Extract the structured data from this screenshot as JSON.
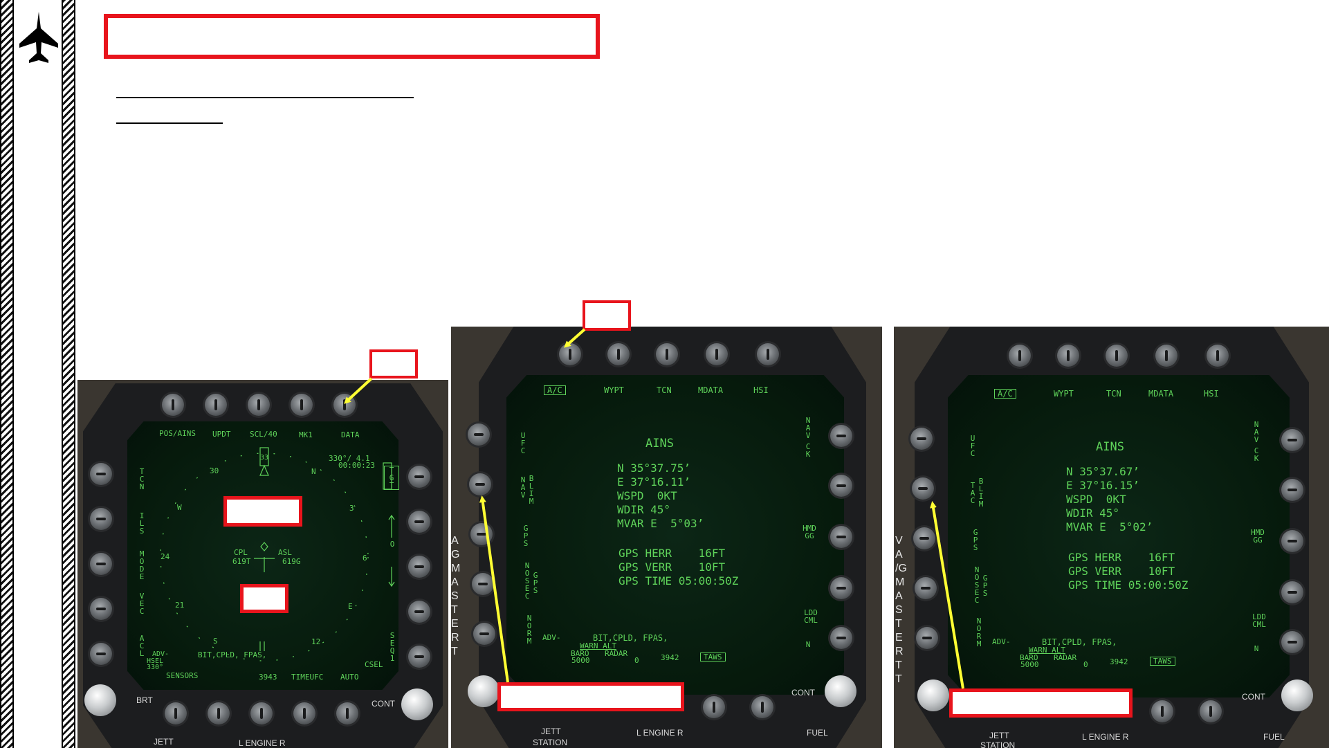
{
  "colors": {
    "accent_red": "#e8141c",
    "arrow_yellow": "#ffff33",
    "display_green": "#5fd35a"
  },
  "logo": {
    "icon": "fighter-jet-icon"
  },
  "mfd1": {
    "top_labels": [
      "POS/AINS",
      "UPDT",
      "SCL/40",
      "MK1",
      "DATA"
    ],
    "left_labels": [
      "TCN",
      "ILS",
      "MODE",
      "VEC",
      "ACL"
    ],
    "right_labels": [
      "TGT",
      "O",
      "SEQ1"
    ],
    "bottom_labels": [
      "SENSORS",
      "3943",
      "TIMEUFC",
      "AUTO"
    ],
    "compass": [
      "30",
      "N",
      "W",
      "3",
      "24",
      "6",
      "21",
      "E",
      "S",
      "12"
    ],
    "top_right_readout_1": "330°/ 4.1",
    "top_right_readout_2": "00:00:23",
    "heading_box": "33",
    "cpl": "CPL",
    "asl": "ASL",
    "cpl_value": "619T",
    "asl_value": "619G",
    "adv": "ADV-",
    "hsel": "HSEL",
    "hsel_value": "330°",
    "bit_line": "BIT,CPLD, FPAS,",
    "csel": "CSEL",
    "brt": "BRT",
    "cont": "CONT",
    "jett": "JETT",
    "engine": "L ENGINE R"
  },
  "mfd2": {
    "top_labels": [
      "A/C",
      "WYPT",
      "TCN",
      "MDATA",
      "HSI"
    ],
    "left_labels": [
      "UFC",
      "NAV",
      "BLIM",
      "GPS",
      "NOSEC",
      "GPS",
      "NORM"
    ],
    "right_labels": [
      "NAV",
      "CK",
      "HMDGG",
      "LDDCML",
      "N"
    ],
    "title": "AINS",
    "lat": "N 35°37.75’",
    "lon": "E 37°16.11’",
    "wspd": "WSPD  0KT",
    "wdir": "WDIR 45°",
    "mvar": "MVAR E  5°03’",
    "gps_herr": "GPS HERR    16FT",
    "gps_verr": "GPS VERR    10FT",
    "gps_time": "GPS TIME 05:00:50Z",
    "adv": "ADV-",
    "bit_line": "BIT,CPLD, FPAS,",
    "warn_alt": "WARN ALT",
    "baro": "BARO",
    "radar": "RADAR",
    "baro_value": "5000",
    "radar_value": "0",
    "alt_value": "3942",
    "taws": "TAWS",
    "cont": "CONT",
    "jett": "JETT",
    "station": "STATION",
    "engine": "L ENGINE R",
    "fuel": "FUEL",
    "side_letters": "A G MASTER T"
  },
  "mfd3": {
    "top_labels": [
      "A/C",
      "WYPT",
      "TCN",
      "MDATA",
      "HSI"
    ],
    "left_labels": [
      "UFC",
      "TAC",
      "BLIM",
      "GPS",
      "NOSEC",
      "GPS",
      "NORM"
    ],
    "right_labels": [
      "NAV",
      "CK",
      "HMDGG",
      "LDDCML",
      "N"
    ],
    "title": "AINS",
    "lat": "N 35°37.67’",
    "lon": "E 37°16.15’",
    "wspd": "WSPD  0KT",
    "wdir": "WDIR 45°",
    "mvar": "MVAR E  5°02’",
    "gps_herr": "GPS HERR    16FT",
    "gps_verr": "GPS VERR    10FT",
    "gps_time": "GPS TIME 05:00:50Z",
    "adv": "ADV-",
    "bit_line": "BIT,CPLD, FPAS,",
    "warn_alt": "WARN ALT",
    "baro": "BARO",
    "radar": "RADAR",
    "baro_value": "5000",
    "radar_value": "0",
    "alt_value": "3942",
    "taws": "TAWS",
    "cont": "CONT",
    "jett": "JETT",
    "station": "STATION",
    "engine": "L ENGINE R",
    "fuel": "FUEL",
    "side_letters": "VA /G MASTER TT"
  }
}
